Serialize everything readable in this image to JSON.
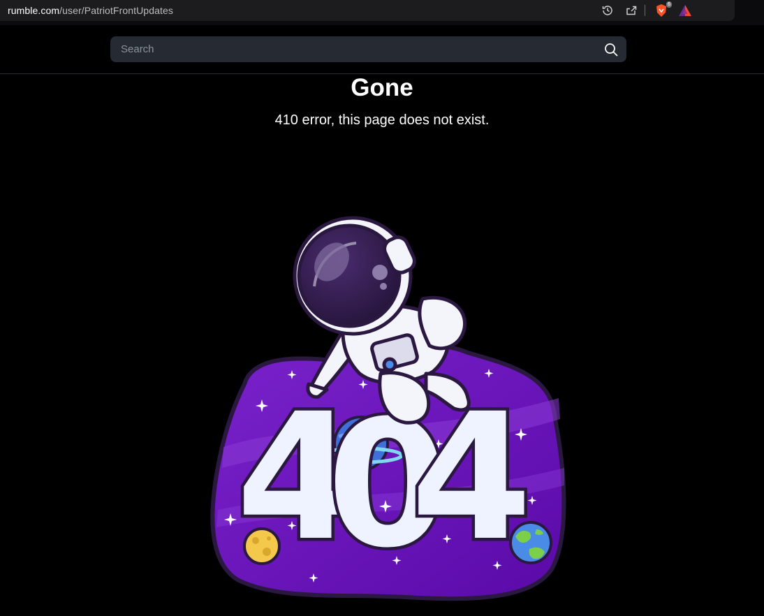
{
  "browser": {
    "url_domain": "rumble.com",
    "url_path": "/user/PatriotFrontUpdates",
    "brave_shield_count": "6",
    "icons": [
      "history-icon",
      "share-icon",
      "brave-shield-icon",
      "brave-rewards-icon"
    ]
  },
  "header": {
    "search_placeholder": "Search",
    "search_icon": "search-icon"
  },
  "error": {
    "title": "Gone",
    "message": "410 error, this page does not exist."
  },
  "illustration": {
    "digits": [
      "4",
      "0",
      "4"
    ],
    "subject": "astronaut"
  },
  "colors": {
    "background": "#000000",
    "search_bg": "#262b33",
    "blob_purple": "#6a0fb8",
    "digit_fill": "#eef3ff",
    "outline": "#2b1840"
  }
}
